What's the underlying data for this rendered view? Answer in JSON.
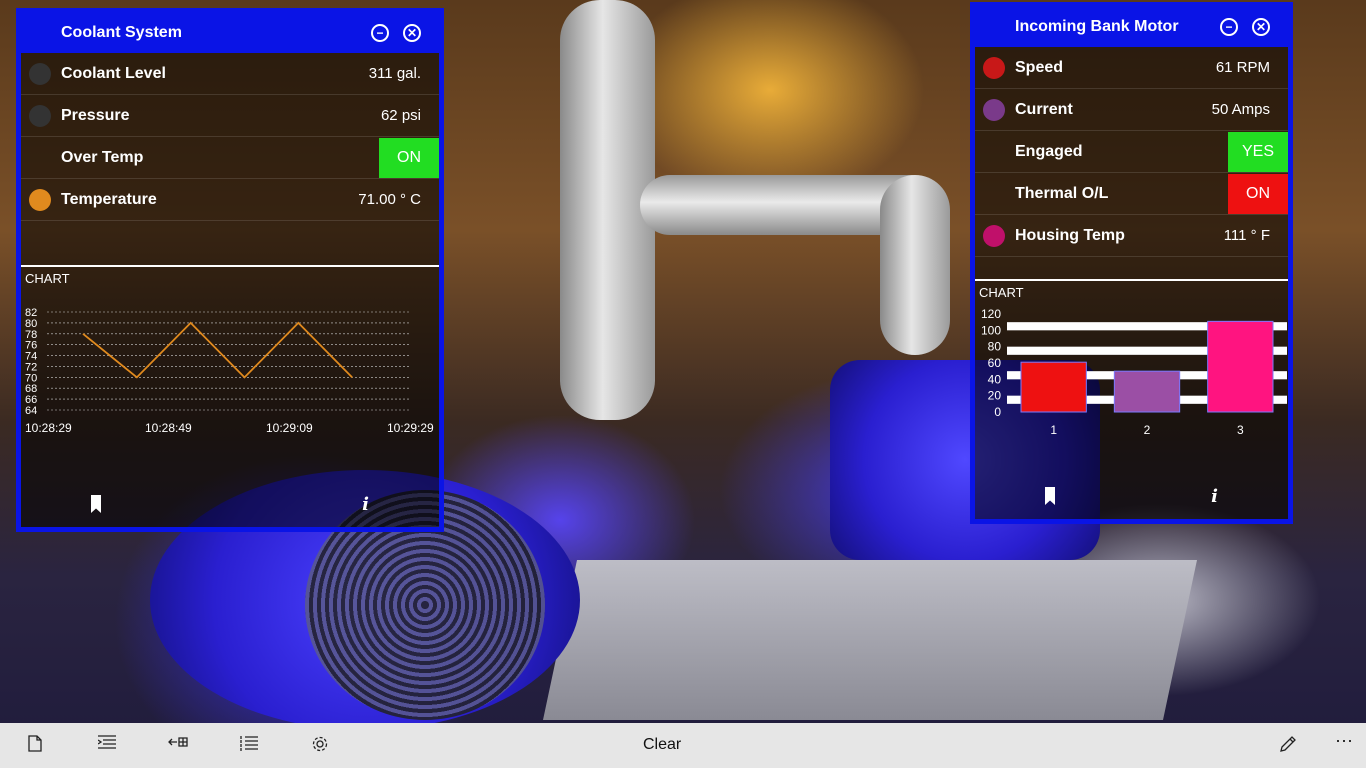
{
  "coolant": {
    "title": "Coolant System",
    "rows": [
      {
        "label": "Coolant Level",
        "value": "311 gal.",
        "dot_color": "#333333"
      },
      {
        "label": "Pressure",
        "value": "62 psi",
        "dot_color": "#333333"
      },
      {
        "label": "Over Temp",
        "value": "ON",
        "badge_color": "#22dd22"
      },
      {
        "label": "Temperature",
        "value": "71.00 ° C",
        "dot_color": "#e08a1e"
      }
    ],
    "chart_label": "CHART"
  },
  "motor": {
    "title": "Incoming Bank Motor",
    "rows": [
      {
        "label": "Speed",
        "value": "61 RPM",
        "dot_color": "#c81818"
      },
      {
        "label": "Current",
        "value": "50 Amps",
        "dot_color": "#7a3a8a"
      },
      {
        "label": "Engaged",
        "value": "YES",
        "badge_color": "#22dd22"
      },
      {
        "label": "Thermal O/L",
        "value": "ON",
        "badge_color": "#ee1111"
      },
      {
        "label": "Housing Temp",
        "value": "111 ° F",
        "dot_color": "#c0106a"
      }
    ],
    "chart_label": "CHART"
  },
  "taskbar": {
    "clear_label": "Clear",
    "icons": [
      "new-document-icon",
      "indent-list-icon",
      "arrow-grid-icon",
      "numbered-list-icon",
      "settings-gear-icon",
      "pencil-icon",
      "more-ellipsis-icon"
    ]
  },
  "chart_data": [
    {
      "type": "line",
      "x": [
        "10:28:29",
        "10:28:39",
        "10:28:49",
        "10:28:59",
        "10:29:09",
        "10:29:19",
        "10:29:29"
      ],
      "x_ticks": [
        "10:28:29",
        "10:28:49",
        "10:29:09",
        "10:29:29"
      ],
      "series": [
        {
          "values": [
            78,
            70,
            80,
            70,
            80,
            70,
            null
          ]
        }
      ],
      "y_ticks": [
        64,
        66,
        68,
        70,
        72,
        74,
        76,
        78,
        80,
        82
      ],
      "ylim": [
        64,
        82
      ],
      "color": "#e08a1e",
      "grid": true
    },
    {
      "type": "bar",
      "categories": [
        "1",
        "2",
        "3"
      ],
      "values": [
        61,
        50,
        111
      ],
      "colors": [
        "#ee1111",
        "#9b4fa5",
        "#ff1480"
      ],
      "y_ticks": [
        0,
        20,
        40,
        60,
        80,
        100,
        120
      ],
      "ylim": [
        0,
        120
      ],
      "grid": true
    }
  ]
}
